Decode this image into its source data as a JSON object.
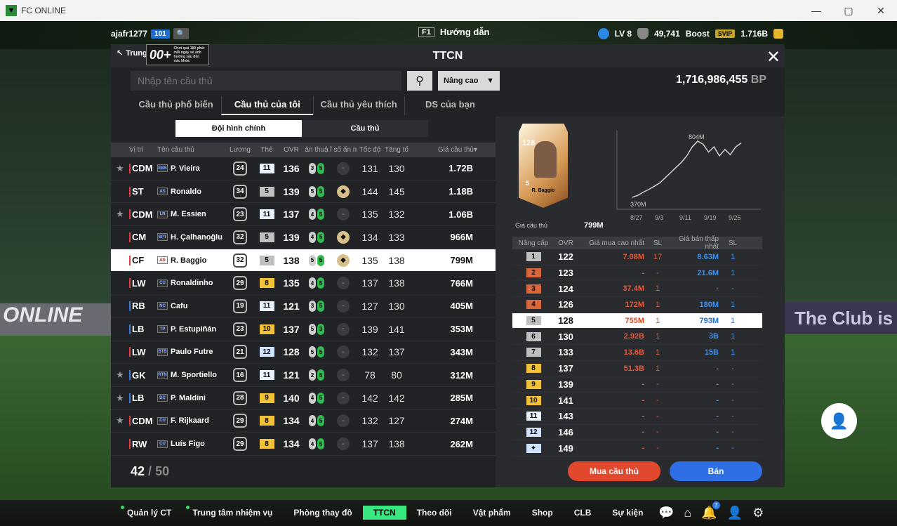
{
  "window": {
    "title": "FC ONLINE",
    "minimize": "—",
    "maximize": "▢",
    "close": "✕"
  },
  "topbar": {
    "username": "ajafr1277",
    "level_badge": "101",
    "help_key": "F1",
    "help_label": "Hướng dẫn",
    "level": "LV 8",
    "points": "49,741",
    "boost": "Boost",
    "svip": "SVIP",
    "coins": "1.716B"
  },
  "background": {
    "ad_left": "ONLINE",
    "ad_right": "The Club is Y"
  },
  "panel": {
    "title": "TTCN",
    "back_label": "Trung",
    "age_number": "00+",
    "age_notice": "Chơi quá 180 phút mỗi ngày sẽ ảnh hưởng xấu đến sức khỏe.",
    "search_placeholder": "Nhập tên cầu thủ",
    "advanced": "Nâng cao",
    "bp_value": "1,716,986,455",
    "bp_unit": "BP",
    "tabs": [
      "Cầu thủ phổ biến",
      "Cầu thủ của tôi",
      "Cầu thủ yêu thích",
      "DS của bạn"
    ],
    "subtabs": [
      "Đội hình chính",
      "Cầu thủ"
    ],
    "columns": [
      "Vị trí",
      "Tên cầu thủ",
      "Lương",
      "Thẻ",
      "OVR",
      "ân thuậ",
      "ĩ số ẩn m",
      "Tốc độ",
      "Tăng tố",
      "Giá cầu thủ▾"
    ],
    "count_current": "42",
    "count_sep": "/",
    "count_max": "50"
  },
  "players": [
    {
      "star": "★",
      "pos": "CDM",
      "season": "EBS",
      "name": "P. Vieira",
      "wage": "24",
      "grade": "11",
      "grade_color": "#e9f2ff",
      "ovr": "136",
      "foot_l": "3",
      "foot_r": "5",
      "skill": "-",
      "skill_gold": false,
      "speed": "131",
      "accel": "130",
      "price": "1.72B"
    },
    {
      "star": "",
      "pos": "ST",
      "season": "AS",
      "name": "Ronaldo",
      "wage": "34",
      "grade": "5",
      "grade_color": "#bfbfbf",
      "ovr": "139",
      "foot_l": "5",
      "foot_r": "5",
      "skill": "◆",
      "skill_gold": true,
      "speed": "144",
      "accel": "145",
      "price": "1.18B"
    },
    {
      "star": "★",
      "pos": "CDM",
      "season": "LN",
      "name": "M. Essien",
      "wage": "23",
      "grade": "11",
      "grade_color": "#e9f2ff",
      "ovr": "137",
      "foot_l": "4",
      "foot_r": "5",
      "skill": "-",
      "skill_gold": false,
      "speed": "135",
      "accel": "132",
      "price": "1.06B"
    },
    {
      "star": "",
      "pos": "CM",
      "season": "SPT",
      "name": "H. Çalhanoğlu",
      "wage": "32",
      "grade": "5",
      "grade_color": "#bfbfbf",
      "ovr": "139",
      "foot_l": "4",
      "foot_r": "5",
      "skill": "◆",
      "skill_gold": true,
      "speed": "134",
      "accel": "133",
      "price": "966M"
    },
    {
      "star": "",
      "pos": "CF",
      "season": "AS",
      "name": "R. Baggio",
      "wage": "32",
      "grade": "5",
      "grade_color": "#bfbfbf",
      "ovr": "138",
      "foot_l": "5",
      "foot_r": "5",
      "skill": "◆",
      "skill_gold": true,
      "speed": "135",
      "accel": "138",
      "price": "799M"
    },
    {
      "star": "",
      "pos": "LW",
      "season": "CU",
      "name": "Ronaldinho",
      "wage": "29",
      "grade": "8",
      "grade_color": "#f2c13a",
      "ovr": "135",
      "foot_l": "4",
      "foot_r": "5",
      "skill": "-",
      "skill_gold": false,
      "speed": "137",
      "accel": "138",
      "price": "766M"
    },
    {
      "star": "",
      "pos": "RB",
      "season": "NC",
      "name": "Cafu",
      "wage": "19",
      "grade": "11",
      "grade_color": "#e9f2ff",
      "ovr": "121",
      "foot_l": "3",
      "foot_r": "5",
      "skill": "-",
      "skill_gold": false,
      "speed": "127",
      "accel": "130",
      "price": "405M"
    },
    {
      "star": "",
      "pos": "LB",
      "season": "TP",
      "name": "P. Estupiñán",
      "wage": "23",
      "grade": "10",
      "grade_color": "#f2c13a",
      "ovr": "137",
      "foot_l": "5",
      "foot_r": "3",
      "skill": "-",
      "skill_gold": false,
      "speed": "139",
      "accel": "141",
      "price": "353M"
    },
    {
      "star": "",
      "pos": "LW",
      "season": "BTB",
      "name": "Paulo Futre",
      "wage": "21",
      "grade": "12",
      "grade_color": "#cfe3ff",
      "ovr": "128",
      "foot_l": "5",
      "foot_r": "5",
      "skill": "-",
      "skill_gold": false,
      "speed": "132",
      "accel": "137",
      "price": "343M"
    },
    {
      "star": "★",
      "pos": "GK",
      "season": "RTN",
      "name": "M. Sportiello",
      "wage": "16",
      "grade": "11",
      "grade_color": "#e9f2ff",
      "ovr": "121",
      "foot_l": "2",
      "foot_r": "5",
      "skill": "-",
      "skill_gold": false,
      "speed": "78",
      "accel": "80",
      "price": "312M"
    },
    {
      "star": "★",
      "pos": "LB",
      "season": "DC",
      "name": "P. Maldini",
      "wage": "28",
      "grade": "9",
      "grade_color": "#f2c13a",
      "ovr": "140",
      "foot_l": "4",
      "foot_r": "5",
      "skill": "-",
      "skill_gold": false,
      "speed": "142",
      "accel": "142",
      "price": "285M"
    },
    {
      "star": "★",
      "pos": "CDM",
      "season": "CU",
      "name": "F. Rijkaard",
      "wage": "29",
      "grade": "8",
      "grade_color": "#f2c13a",
      "ovr": "134",
      "foot_l": "4",
      "foot_r": "5",
      "skill": "-",
      "skill_gold": false,
      "speed": "132",
      "accel": "127",
      "price": "274M"
    },
    {
      "star": "",
      "pos": "RW",
      "season": "CU",
      "name": "Luís Figo",
      "wage": "29",
      "grade": "8",
      "grade_color": "#f2c13a",
      "ovr": "134",
      "foot_l": "4",
      "foot_r": "5",
      "skill": "-",
      "skill_gold": false,
      "speed": "137",
      "accel": "138",
      "price": "262M"
    }
  ],
  "detail": {
    "card_ovr": "128",
    "card_level": "5",
    "card_name": "R. Baggio",
    "price_label": "Giá cầu thủ",
    "price_value": "799M",
    "chart_max_label": "804M",
    "chart_min_label": "370M",
    "chart_dates": [
      "8/27",
      "9/3",
      "9/11",
      "9/19",
      "9/25"
    ],
    "columns": [
      "Nâng cấp",
      "OVR",
      "Giá mua cao nhất",
      "SL",
      "Giá bán thấp nhất",
      "SL"
    ],
    "buy_button": "Mua cầu thủ",
    "sell_button": "Bán"
  },
  "grades": [
    {
      "lv": "1",
      "color": "#bfbfbf",
      "ovr": "122",
      "buy": "7.08M",
      "bq": "17",
      "sell": "8.63M",
      "sq": "1"
    },
    {
      "lv": "2",
      "color": "#d9673c",
      "ovr": "123",
      "buy": "-",
      "bq": "-",
      "sell": "21.6M",
      "sq": "1"
    },
    {
      "lv": "3",
      "color": "#d9673c",
      "ovr": "124",
      "buy": "37.4M",
      "bq": "1",
      "sell": "-",
      "sq": "-"
    },
    {
      "lv": "4",
      "color": "#d9673c",
      "ovr": "126",
      "buy": "172M",
      "bq": "1",
      "sell": "180M",
      "sq": "1"
    },
    {
      "lv": "5",
      "color": "#bfbfbf",
      "ovr": "128",
      "buy": "755M",
      "bq": "1",
      "sell": "793M",
      "sq": "1"
    },
    {
      "lv": "6",
      "color": "#bfbfbf",
      "ovr": "130",
      "buy": "2.92B",
      "bq": "1",
      "sell": "3B",
      "sq": "1"
    },
    {
      "lv": "7",
      "color": "#bfbfbf",
      "ovr": "133",
      "buy": "13.6B",
      "bq": "1",
      "sell": "15B",
      "sq": "1"
    },
    {
      "lv": "8",
      "color": "#f2c13a",
      "ovr": "137",
      "buy": "51.3B",
      "bq": "1",
      "sell": "-",
      "sq": "-"
    },
    {
      "lv": "9",
      "color": "#f2c13a",
      "ovr": "139",
      "buy": "-",
      "bq": "-",
      "sell": "-",
      "sq": "-"
    },
    {
      "lv": "10",
      "color": "#f2c13a",
      "ovr": "141",
      "buy": "-",
      "bq": "-",
      "sell": "-",
      "sq": "-"
    },
    {
      "lv": "11",
      "color": "#e9f2ff",
      "ovr": "143",
      "buy": "-",
      "bq": "-",
      "sell": "-",
      "sq": "-"
    },
    {
      "lv": "12",
      "color": "#cfe3ff",
      "ovr": "146",
      "buy": "-",
      "bq": "-",
      "sell": "-",
      "sq": "-"
    },
    {
      "lv": "✦",
      "color": "#cfe3ff",
      "ovr": "149",
      "buy": "-",
      "bq": "-",
      "sell": "-",
      "sq": "-"
    }
  ],
  "price_series": [
    370,
    385,
    410,
    430,
    455,
    480,
    520,
    560,
    600,
    640,
    690,
    760,
    804,
    780,
    720,
    760,
    690,
    740,
    700,
    760,
    790
  ],
  "bottom_nav": [
    {
      "label": "Quản lý CT",
      "dot": true,
      "active": false
    },
    {
      "label": "Trung tâm nhiệm vụ",
      "dot": true,
      "active": false
    },
    {
      "label": "Phòng thay đồ",
      "dot": false,
      "active": false
    },
    {
      "label": "TTCN",
      "dot": false,
      "active": true
    },
    {
      "label": "Theo dõi",
      "dot": false,
      "active": false
    },
    {
      "label": "Vật phẩm",
      "dot": false,
      "active": false
    },
    {
      "label": "Shop",
      "dot": false,
      "active": false
    },
    {
      "label": "CLB",
      "dot": false,
      "active": false
    },
    {
      "label": "Sự kiện",
      "dot": false,
      "active": false
    }
  ],
  "notif_count": "7"
}
